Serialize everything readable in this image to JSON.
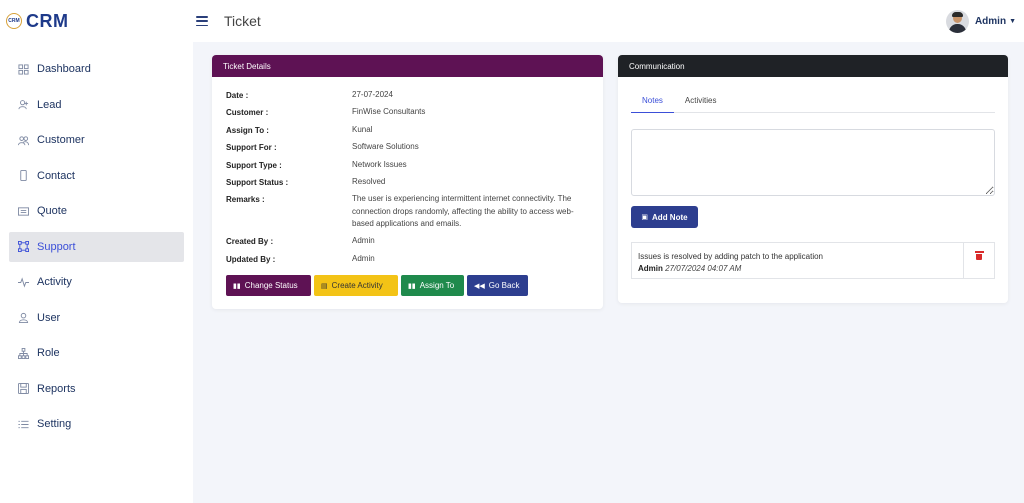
{
  "brand": {
    "logo_text": "CRM",
    "name": "CRM"
  },
  "sidebar": {
    "items": [
      {
        "label": "Dashboard",
        "icon": "grid-icon"
      },
      {
        "label": "Lead",
        "icon": "user-plus-icon"
      },
      {
        "label": "Customer",
        "icon": "users-icon"
      },
      {
        "label": "Contact",
        "icon": "phone-icon"
      },
      {
        "label": "Quote",
        "icon": "document-icon"
      },
      {
        "label": "Support",
        "icon": "support-icon",
        "active": true
      },
      {
        "label": "Activity",
        "icon": "pulse-icon"
      },
      {
        "label": "User",
        "icon": "user-icon"
      },
      {
        "label": "Role",
        "icon": "hierarchy-icon"
      },
      {
        "label": "Reports",
        "icon": "save-icon"
      },
      {
        "label": "Setting",
        "icon": "list-icon"
      }
    ]
  },
  "header": {
    "title": "Ticket",
    "user_name": "Admin"
  },
  "ticket": {
    "header": "Ticket Details",
    "fields": [
      {
        "label": "Date :",
        "value": "27-07-2024"
      },
      {
        "label": "Customer :",
        "value": "FinWise Consultants"
      },
      {
        "label": "Assign To :",
        "value": "Kunal"
      },
      {
        "label": "Support For :",
        "value": "Software Solutions"
      },
      {
        "label": "Support Type :",
        "value": "Network Issues"
      },
      {
        "label": "Support Status :",
        "value": "Resolved"
      },
      {
        "label": "Remarks :",
        "value": "The user is experiencing intermittent internet connectivity. The connection drops randomly, affecting the ability to access web-based applications and emails."
      },
      {
        "label": "Created By :",
        "value": "Admin"
      },
      {
        "label": "Updated By :",
        "value": "Admin"
      }
    ],
    "buttons": {
      "change_status": "Change Status",
      "create_activity": "Create Activity",
      "assign_to": "Assign To",
      "go_back": "Go Back"
    }
  },
  "communication": {
    "header": "Communication",
    "tabs": [
      "Notes",
      "Activities"
    ],
    "active_tab": "Notes",
    "note_input": {
      "value": "",
      "placeholder": ""
    },
    "add_note_label": "Add Note",
    "notes": [
      {
        "text": "Issues is resolved by adding patch to the application",
        "author": "Admin",
        "timestamp": "27/07/2024 04:07 AM"
      }
    ]
  },
  "colors": {
    "ticket_header": "#5e1254",
    "comm_header": "#1f2226",
    "primary": "#2d3e8f",
    "warning": "#f3c316",
    "success": "#1f8a4c",
    "danger": "#d92b2b",
    "active_nav": "#3b4fd8"
  }
}
